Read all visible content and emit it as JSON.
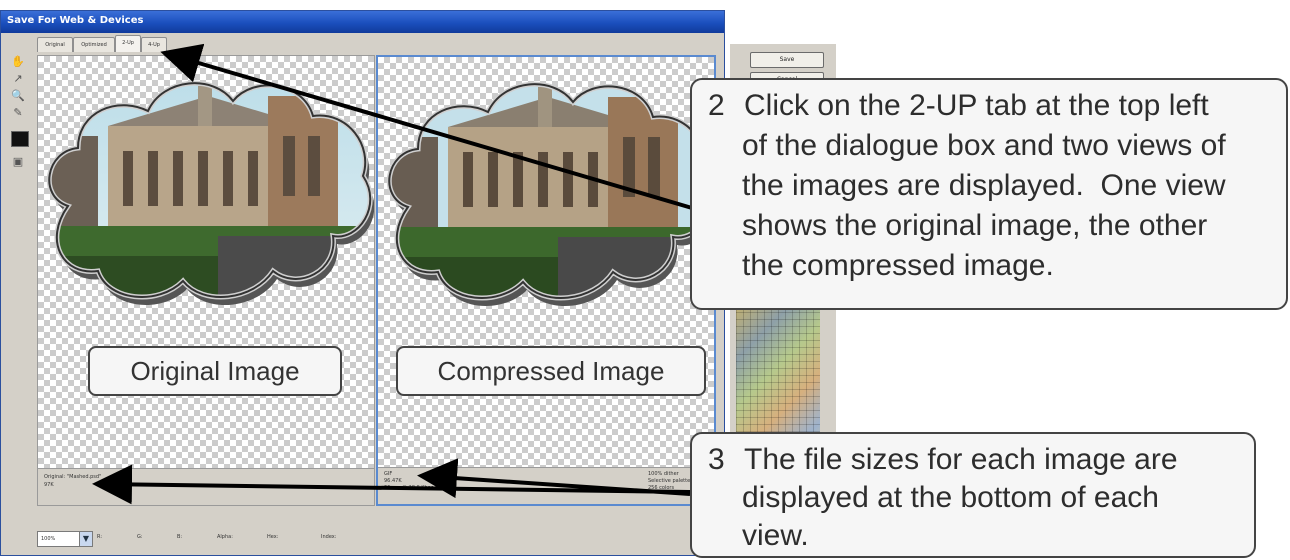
{
  "window": {
    "title": "Save For Web & Devices",
    "tabs": [
      "Original",
      "Optimized",
      "2-Up",
      "4-Up"
    ],
    "active_tab_index": 2
  },
  "tools": [
    "hand-icon",
    "slice-select-icon",
    "zoom-icon",
    "eyedropper-icon",
    "color-swatch",
    "toggle-slices-icon"
  ],
  "views": {
    "original": {
      "info_line1": "Original: \"Mashed.psd\"",
      "info_line2": "97K"
    },
    "compressed": {
      "info_line1": "GIF",
      "info_line2": "96.47K",
      "info_line3": "36 sec @ 28.8 Kbps",
      "info_right1": "100% dither",
      "info_right2": "Selective palette",
      "info_right3": "256 colors"
    }
  },
  "side_panel": {
    "save_label": "Save",
    "cancel_label": "Cancel"
  },
  "bottom_bar": {
    "zoom_value": "100%",
    "channels": [
      "R:",
      "G:",
      "B:",
      "Alpha:",
      "Hex:",
      "Index:"
    ]
  },
  "labels": {
    "original": "Original Image",
    "compressed": "Compressed Image"
  },
  "callouts": {
    "step2": {
      "number": "2",
      "lines": [
        "Click on the 2-UP tab at the top left",
        "of the dialogue box and two views of",
        "the images are displayed.  One view",
        "shows the original image, the other",
        "the compressed image."
      ]
    },
    "step3": {
      "number": "3",
      "lines": [
        "The file sizes for each image are",
        "displayed at the bottom of each",
        "view."
      ]
    }
  },
  "colors": {
    "titlebar": "#1b4fbd",
    "dialog_bg": "#d4d0c8",
    "selected_view_border": "#5a8ad0",
    "callout_bg": "#f6f6f6",
    "callout_border": "#444444",
    "arrow": "#000000"
  }
}
